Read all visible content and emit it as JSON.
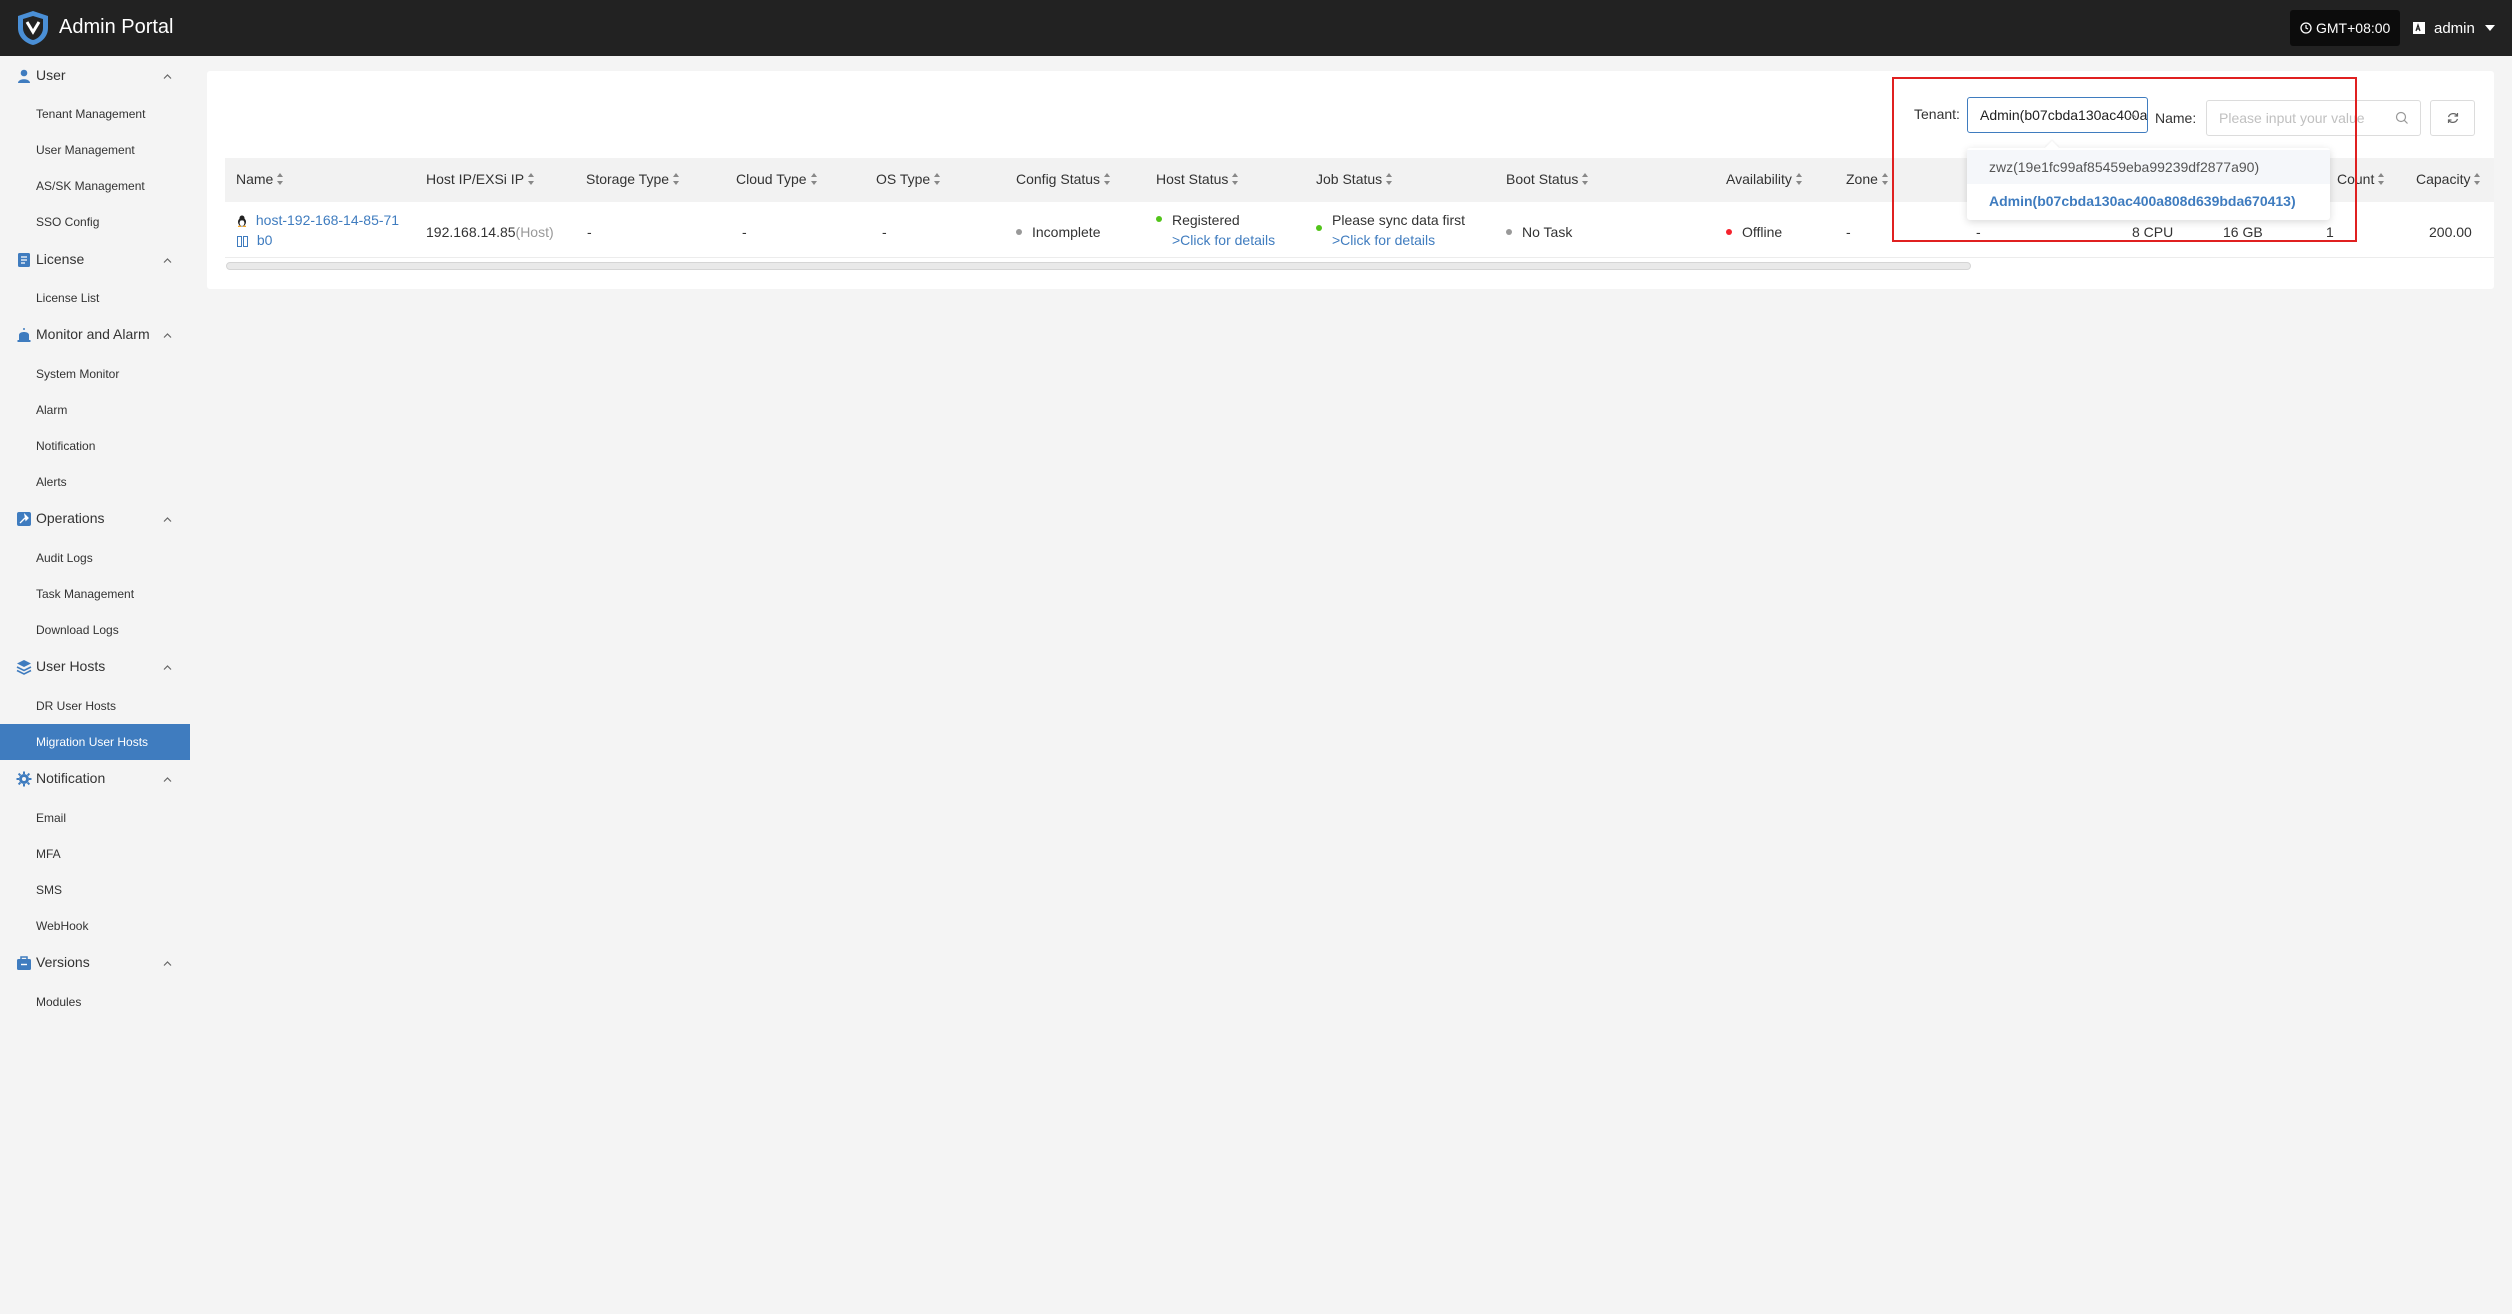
{
  "header": {
    "app_title": "Admin Portal",
    "timezone": "GMT+08:00",
    "user": "admin"
  },
  "sidebar": {
    "groups": [
      {
        "label": "User",
        "icon": "user-icon",
        "items": [
          "Tenant Management",
          "User Management",
          "AS/SK Management",
          "SSO Config"
        ]
      },
      {
        "label": "License",
        "icon": "license-icon",
        "items": [
          "License List"
        ]
      },
      {
        "label": "Monitor and Alarm",
        "icon": "alarm-icon",
        "items": [
          "System Monitor",
          "Alarm",
          "Notification",
          "Alerts"
        ]
      },
      {
        "label": "Operations",
        "icon": "operations-icon",
        "items": [
          "Audit Logs",
          "Task Management",
          "Download Logs"
        ]
      },
      {
        "label": "User Hosts",
        "icon": "hosts-icon",
        "items": [
          "DR User Hosts",
          "Migration User Hosts"
        ]
      },
      {
        "label": "Notification",
        "icon": "gear-icon",
        "items": [
          "Email",
          "MFA",
          "SMS",
          "WebHook"
        ]
      },
      {
        "label": "Versions",
        "icon": "versions-icon",
        "items": [
          "Modules"
        ]
      }
    ],
    "active_item": "Migration User Hosts"
  },
  "filters": {
    "tenant_label": "Tenant:",
    "tenant_value": "Admin(b07cbda130ac400a808d639bda670413)",
    "name_label": "Name:",
    "name_placeholder": "Please input your value"
  },
  "dropdown": {
    "options": [
      "zwz(19e1fc99af85459eba99239df2877a90)",
      "Admin(b07cbda130ac400a808d639bda670413)"
    ],
    "selected_index": 1
  },
  "table": {
    "columns": [
      "Name",
      "Host IP/EXSi IP",
      "Storage Type",
      "Cloud Type",
      "OS Type",
      "Config Status",
      "Host Status",
      "Job Status",
      "Boot Status",
      "Availability",
      "Zone",
      "Count",
      "Capacity"
    ],
    "rows": [
      {
        "name_line1": "host-192-168-14-85-71",
        "name_line2": "b0",
        "host_ip": "192.168.14.85",
        "host_ip_suffix": "(Host)",
        "storage_type": "-",
        "cloud_type": "-",
        "os_type": "-",
        "config_status": "Incomplete",
        "host_status": "Registered",
        "host_status_link": ">Click for details",
        "job_status": "Please sync data first",
        "job_status_link": ">Click for details",
        "boot_status": "No Task",
        "availability": "Offline",
        "zone": "-",
        "hidden_col": "-",
        "cpu": "8 CPU",
        "memory": "16 GB",
        "count": "1",
        "capacity": "200.00"
      }
    ]
  },
  "colors": {
    "accent": "#3f7cbf",
    "header_bg": "#222222",
    "status_grey": "#999999",
    "status_green": "#52c41a",
    "status_red": "#f5222d",
    "highlight": "#e02020"
  }
}
